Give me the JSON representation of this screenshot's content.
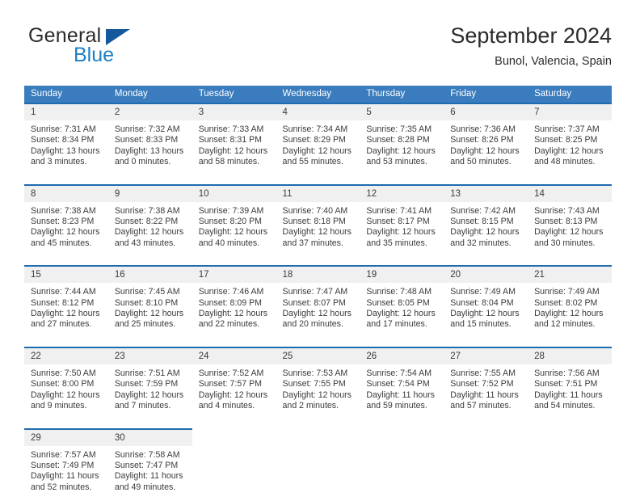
{
  "brand": {
    "name_part1": "General",
    "name_part2": "Blue",
    "mark": "triangle-logo"
  },
  "header": {
    "title": "September 2024",
    "location": "Bunol, Valencia, Spain"
  },
  "theme": {
    "header_blue": "#3a7cbe",
    "row_border_blue": "#1f6bb0",
    "daynum_bg": "#f0f0f0",
    "brand_blue": "#1d7fc3",
    "mark_blue": "#15599c"
  },
  "labels": {
    "sunrise_prefix": "Sunrise:",
    "sunset_prefix": "Sunset:",
    "daylight_prefix": "Daylight:"
  },
  "weekdays": [
    "Sunday",
    "Monday",
    "Tuesday",
    "Wednesday",
    "Thursday",
    "Friday",
    "Saturday"
  ],
  "weeks": [
    [
      {
        "day": "1",
        "sunrise": "Sunrise: 7:31 AM",
        "sunset": "Sunset: 8:34 PM",
        "daylight_line1": "Daylight: 13 hours",
        "daylight_line2": "and 3 minutes."
      },
      {
        "day": "2",
        "sunrise": "Sunrise: 7:32 AM",
        "sunset": "Sunset: 8:33 PM",
        "daylight_line1": "Daylight: 13 hours",
        "daylight_line2": "and 0 minutes."
      },
      {
        "day": "3",
        "sunrise": "Sunrise: 7:33 AM",
        "sunset": "Sunset: 8:31 PM",
        "daylight_line1": "Daylight: 12 hours",
        "daylight_line2": "and 58 minutes."
      },
      {
        "day": "4",
        "sunrise": "Sunrise: 7:34 AM",
        "sunset": "Sunset: 8:29 PM",
        "daylight_line1": "Daylight: 12 hours",
        "daylight_line2": "and 55 minutes."
      },
      {
        "day": "5",
        "sunrise": "Sunrise: 7:35 AM",
        "sunset": "Sunset: 8:28 PM",
        "daylight_line1": "Daylight: 12 hours",
        "daylight_line2": "and 53 minutes."
      },
      {
        "day": "6",
        "sunrise": "Sunrise: 7:36 AM",
        "sunset": "Sunset: 8:26 PM",
        "daylight_line1": "Daylight: 12 hours",
        "daylight_line2": "and 50 minutes."
      },
      {
        "day": "7",
        "sunrise": "Sunrise: 7:37 AM",
        "sunset": "Sunset: 8:25 PM",
        "daylight_line1": "Daylight: 12 hours",
        "daylight_line2": "and 48 minutes."
      }
    ],
    [
      {
        "day": "8",
        "sunrise": "Sunrise: 7:38 AM",
        "sunset": "Sunset: 8:23 PM",
        "daylight_line1": "Daylight: 12 hours",
        "daylight_line2": "and 45 minutes."
      },
      {
        "day": "9",
        "sunrise": "Sunrise: 7:38 AM",
        "sunset": "Sunset: 8:22 PM",
        "daylight_line1": "Daylight: 12 hours",
        "daylight_line2": "and 43 minutes."
      },
      {
        "day": "10",
        "sunrise": "Sunrise: 7:39 AM",
        "sunset": "Sunset: 8:20 PM",
        "daylight_line1": "Daylight: 12 hours",
        "daylight_line2": "and 40 minutes."
      },
      {
        "day": "11",
        "sunrise": "Sunrise: 7:40 AM",
        "sunset": "Sunset: 8:18 PM",
        "daylight_line1": "Daylight: 12 hours",
        "daylight_line2": "and 37 minutes."
      },
      {
        "day": "12",
        "sunrise": "Sunrise: 7:41 AM",
        "sunset": "Sunset: 8:17 PM",
        "daylight_line1": "Daylight: 12 hours",
        "daylight_line2": "and 35 minutes."
      },
      {
        "day": "13",
        "sunrise": "Sunrise: 7:42 AM",
        "sunset": "Sunset: 8:15 PM",
        "daylight_line1": "Daylight: 12 hours",
        "daylight_line2": "and 32 minutes."
      },
      {
        "day": "14",
        "sunrise": "Sunrise: 7:43 AM",
        "sunset": "Sunset: 8:13 PM",
        "daylight_line1": "Daylight: 12 hours",
        "daylight_line2": "and 30 minutes."
      }
    ],
    [
      {
        "day": "15",
        "sunrise": "Sunrise: 7:44 AM",
        "sunset": "Sunset: 8:12 PM",
        "daylight_line1": "Daylight: 12 hours",
        "daylight_line2": "and 27 minutes."
      },
      {
        "day": "16",
        "sunrise": "Sunrise: 7:45 AM",
        "sunset": "Sunset: 8:10 PM",
        "daylight_line1": "Daylight: 12 hours",
        "daylight_line2": "and 25 minutes."
      },
      {
        "day": "17",
        "sunrise": "Sunrise: 7:46 AM",
        "sunset": "Sunset: 8:09 PM",
        "daylight_line1": "Daylight: 12 hours",
        "daylight_line2": "and 22 minutes."
      },
      {
        "day": "18",
        "sunrise": "Sunrise: 7:47 AM",
        "sunset": "Sunset: 8:07 PM",
        "daylight_line1": "Daylight: 12 hours",
        "daylight_line2": "and 20 minutes."
      },
      {
        "day": "19",
        "sunrise": "Sunrise: 7:48 AM",
        "sunset": "Sunset: 8:05 PM",
        "daylight_line1": "Daylight: 12 hours",
        "daylight_line2": "and 17 minutes."
      },
      {
        "day": "20",
        "sunrise": "Sunrise: 7:49 AM",
        "sunset": "Sunset: 8:04 PM",
        "daylight_line1": "Daylight: 12 hours",
        "daylight_line2": "and 15 minutes."
      },
      {
        "day": "21",
        "sunrise": "Sunrise: 7:49 AM",
        "sunset": "Sunset: 8:02 PM",
        "daylight_line1": "Daylight: 12 hours",
        "daylight_line2": "and 12 minutes."
      }
    ],
    [
      {
        "day": "22",
        "sunrise": "Sunrise: 7:50 AM",
        "sunset": "Sunset: 8:00 PM",
        "daylight_line1": "Daylight: 12 hours",
        "daylight_line2": "and 9 minutes."
      },
      {
        "day": "23",
        "sunrise": "Sunrise: 7:51 AM",
        "sunset": "Sunset: 7:59 PM",
        "daylight_line1": "Daylight: 12 hours",
        "daylight_line2": "and 7 minutes."
      },
      {
        "day": "24",
        "sunrise": "Sunrise: 7:52 AM",
        "sunset": "Sunset: 7:57 PM",
        "daylight_line1": "Daylight: 12 hours",
        "daylight_line2": "and 4 minutes."
      },
      {
        "day": "25",
        "sunrise": "Sunrise: 7:53 AM",
        "sunset": "Sunset: 7:55 PM",
        "daylight_line1": "Daylight: 12 hours",
        "daylight_line2": "and 2 minutes."
      },
      {
        "day": "26",
        "sunrise": "Sunrise: 7:54 AM",
        "sunset": "Sunset: 7:54 PM",
        "daylight_line1": "Daylight: 11 hours",
        "daylight_line2": "and 59 minutes."
      },
      {
        "day": "27",
        "sunrise": "Sunrise: 7:55 AM",
        "sunset": "Sunset: 7:52 PM",
        "daylight_line1": "Daylight: 11 hours",
        "daylight_line2": "and 57 minutes."
      },
      {
        "day": "28",
        "sunrise": "Sunrise: 7:56 AM",
        "sunset": "Sunset: 7:51 PM",
        "daylight_line1": "Daylight: 11 hours",
        "daylight_line2": "and 54 minutes."
      }
    ],
    [
      {
        "day": "29",
        "sunrise": "Sunrise: 7:57 AM",
        "sunset": "Sunset: 7:49 PM",
        "daylight_line1": "Daylight: 11 hours",
        "daylight_line2": "and 52 minutes."
      },
      {
        "day": "30",
        "sunrise": "Sunrise: 7:58 AM",
        "sunset": "Sunset: 7:47 PM",
        "daylight_line1": "Daylight: 11 hours",
        "daylight_line2": "and 49 minutes."
      },
      {
        "day": "",
        "sunrise": "",
        "sunset": "",
        "daylight_line1": "",
        "daylight_line2": ""
      },
      {
        "day": "",
        "sunrise": "",
        "sunset": "",
        "daylight_line1": "",
        "daylight_line2": ""
      },
      {
        "day": "",
        "sunrise": "",
        "sunset": "",
        "daylight_line1": "",
        "daylight_line2": ""
      },
      {
        "day": "",
        "sunrise": "",
        "sunset": "",
        "daylight_line1": "",
        "daylight_line2": ""
      },
      {
        "day": "",
        "sunrise": "",
        "sunset": "",
        "daylight_line1": "",
        "daylight_line2": ""
      }
    ]
  ]
}
